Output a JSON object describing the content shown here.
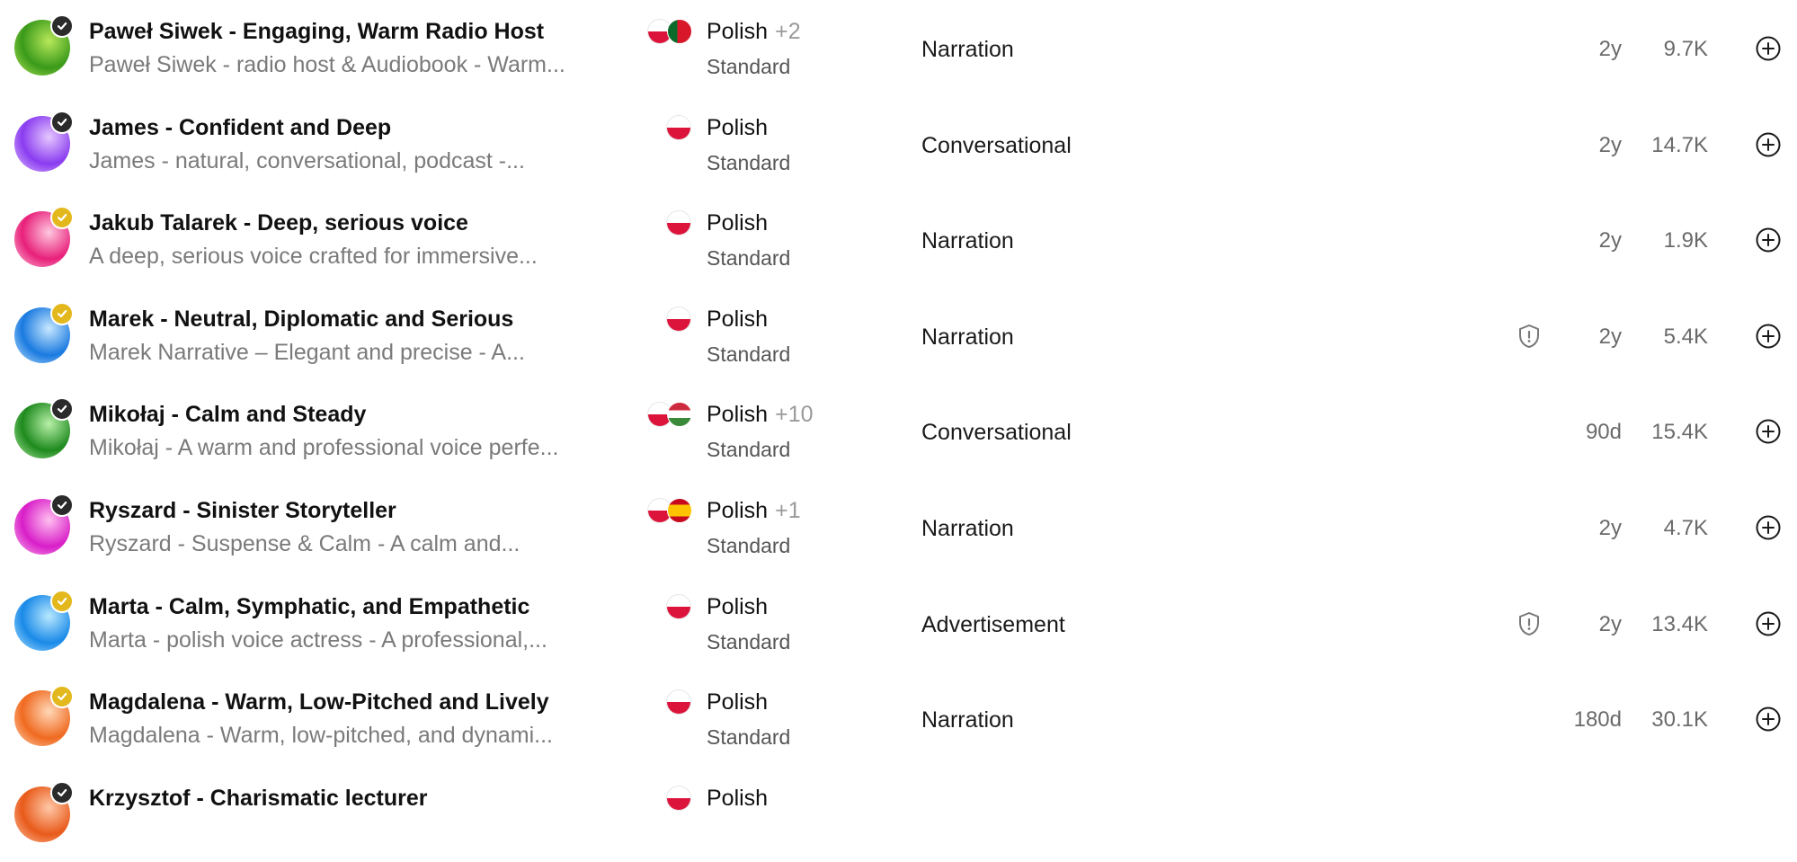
{
  "voices": [
    {
      "name": "Paweł Siwek - Engaging, Warm Radio Host",
      "description": "Paweł Siwek - radio host & Audiobook - Warm...",
      "language": "Polish",
      "extra_languages": "+2",
      "tier": "Standard",
      "category": "Narration",
      "age": "2y",
      "uses": "9.7K",
      "verified": "dark",
      "second_flag": "portugal",
      "shield": false,
      "avatar_colors": [
        "#3a9a1a",
        "#b8e85a"
      ]
    },
    {
      "name": "James - Confident and Deep",
      "description": "James - natural, conversational, podcast -...",
      "language": "Polish",
      "extra_languages": "",
      "tier": "Standard",
      "category": "Conversational",
      "age": "2y",
      "uses": "14.7K",
      "verified": "dark",
      "second_flag": "",
      "shield": false,
      "avatar_colors": [
        "#8a3cf0",
        "#e6c8ff"
      ]
    },
    {
      "name": "Jakub Talarek - Deep, serious voice",
      "description": "A deep, serious voice crafted for immersive...",
      "language": "Polish",
      "extra_languages": "",
      "tier": "Standard",
      "category": "Narration",
      "age": "2y",
      "uses": "1.9K",
      "verified": "gold",
      "second_flag": "",
      "shield": false,
      "avatar_colors": [
        "#e8207a",
        "#ffc8e0"
      ]
    },
    {
      "name": "Marek - Neutral, Diplomatic and Serious",
      "description": "Marek Narrative – Elegant and precise - A...",
      "language": "Polish",
      "extra_languages": "",
      "tier": "Standard",
      "category": "Narration",
      "age": "2y",
      "uses": "5.4K",
      "verified": "gold",
      "second_flag": "",
      "shield": true,
      "avatar_colors": [
        "#1a7ae0",
        "#c8e8ff"
      ]
    },
    {
      "name": "Mikołaj - Calm and Steady",
      "description": "Mikołaj - A warm and professional voice perfe...",
      "language": "Polish",
      "extra_languages": "+10",
      "tier": "Standard",
      "category": "Conversational",
      "age": "90d",
      "uses": "15.4K",
      "verified": "dark",
      "second_flag": "hungary",
      "shield": false,
      "avatar_colors": [
        "#1e8a1e",
        "#b8f0a8"
      ]
    },
    {
      "name": "Ryszard - Sinister Storyteller",
      "description": "Ryszard - Suspense & Calm - A calm and...",
      "language": "Polish",
      "extra_languages": "+1",
      "tier": "Standard",
      "category": "Narration",
      "age": "2y",
      "uses": "4.7K",
      "verified": "dark",
      "second_flag": "spain",
      "shield": false,
      "avatar_colors": [
        "#d81ec8",
        "#ffc0f0"
      ]
    },
    {
      "name": "Marta - Calm, Symphatic, and Empathetic",
      "description": "Marta - polish voice actress - A professional,...",
      "language": "Polish",
      "extra_languages": "",
      "tier": "Standard",
      "category": "Advertisement",
      "age": "2y",
      "uses": "13.4K",
      "verified": "gold",
      "second_flag": "",
      "shield": true,
      "avatar_colors": [
        "#1a8ae8",
        "#b8e8ff"
      ]
    },
    {
      "name": "Magdalena - Warm, Low-Pitched and Lively",
      "description": "Magdalena - Warm, low-pitched, and dynami...",
      "language": "Polish",
      "extra_languages": "",
      "tier": "Standard",
      "category": "Narration",
      "age": "180d",
      "uses": "30.1K",
      "verified": "gold",
      "second_flag": "",
      "shield": false,
      "avatar_colors": [
        "#f06a20",
        "#ffd8b8"
      ]
    },
    {
      "name": "Krzysztof - Charismatic lecturer",
      "description": "",
      "language": "Polish",
      "extra_languages": "",
      "tier": "",
      "category": "",
      "age": "",
      "uses": "",
      "verified": "dark",
      "second_flag": "",
      "shield": false,
      "avatar_colors": [
        "#e85a1a",
        "#ffc8a8"
      ]
    }
  ],
  "colors": {
    "verified_dark": "#2b2b2b",
    "verified_gold": "#e3b81c",
    "poland_red": "#dc143c"
  }
}
